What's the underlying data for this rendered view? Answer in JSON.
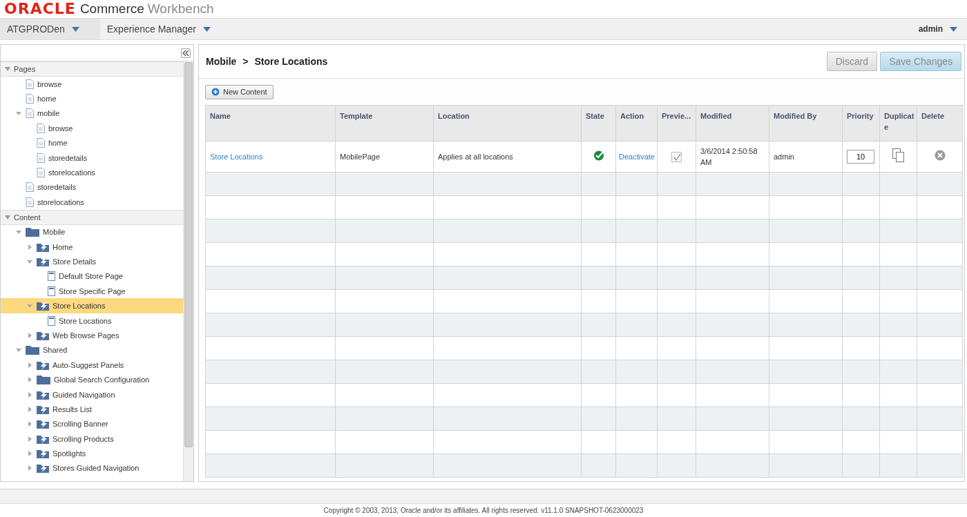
{
  "header": {
    "brand": "ORACLE",
    "product": "Commerce",
    "product_suffix": "Workbench"
  },
  "nav": {
    "menus": [
      {
        "label": "ATGPRODen",
        "selected": true
      },
      {
        "label": "Experience Manager",
        "selected": false
      }
    ],
    "user": "admin"
  },
  "sidebar": {
    "sections": [
      {
        "label": "Pages",
        "expanded": true,
        "items": [
          {
            "label": "browse",
            "kind": "page",
            "selected": false
          },
          {
            "label": "home",
            "kind": "page",
            "selected": false
          },
          {
            "label": "mobile",
            "kind": "page",
            "selected": false,
            "expanded": true,
            "children": [
              {
                "label": "browse",
                "kind": "page",
                "selected": false
              },
              {
                "label": "home",
                "kind": "page",
                "selected": false
              },
              {
                "label": "storedetails",
                "kind": "page",
                "selected": false
              },
              {
                "label": "storelocations",
                "kind": "page",
                "selected": false
              }
            ]
          },
          {
            "label": "storedetails",
            "kind": "page",
            "selected": false
          },
          {
            "label": "storelocations",
            "kind": "page",
            "selected": false
          }
        ]
      },
      {
        "label": "Content",
        "expanded": true,
        "items": [
          {
            "label": "Mobile",
            "kind": "folder",
            "selected": false,
            "expanded": true,
            "children": [
              {
                "label": "Home",
                "kind": "collection",
                "selected": false,
                "expanded": false
              },
              {
                "label": "Store Details",
                "kind": "collection",
                "selected": false,
                "expanded": true,
                "children": [
                  {
                    "label": "Default Store Page",
                    "kind": "doc",
                    "selected": false
                  },
                  {
                    "label": "Store Specific Page",
                    "kind": "doc",
                    "selected": false
                  }
                ]
              },
              {
                "label": "Store Locations",
                "kind": "collection",
                "selected": true,
                "expanded": true,
                "children": [
                  {
                    "label": "Store Locations",
                    "kind": "doc",
                    "selected": false
                  }
                ]
              },
              {
                "label": "Web Browse Pages",
                "kind": "collection",
                "selected": false,
                "expanded": false
              }
            ]
          },
          {
            "label": "Shared",
            "kind": "folder",
            "selected": false,
            "expanded": true,
            "children": [
              {
                "label": "Auto-Suggest Panels",
                "kind": "collection",
                "selected": false,
                "expanded": false
              },
              {
                "label": "Global Search Configuration",
                "kind": "folder",
                "selected": false,
                "expanded": false
              },
              {
                "label": "Guided Navigation",
                "kind": "collection",
                "selected": false,
                "expanded": false
              },
              {
                "label": "Results List",
                "kind": "collection",
                "selected": false,
                "expanded": false
              },
              {
                "label": "Scrolling Banner",
                "kind": "collection",
                "selected": false,
                "expanded": false
              },
              {
                "label": "Scrolling Products",
                "kind": "collection",
                "selected": false,
                "expanded": false
              },
              {
                "label": "Spotlights",
                "kind": "collection",
                "selected": false,
                "expanded": false
              },
              {
                "label": "Stores Guided Navigation",
                "kind": "collection",
                "selected": false,
                "expanded": false
              }
            ]
          }
        ]
      }
    ]
  },
  "main": {
    "breadcrumb": [
      "Mobile",
      ">",
      "Store Locations"
    ],
    "buttons": [
      {
        "label": "Discard",
        "kind": "secondary",
        "disabled": true
      },
      {
        "label": "Save Changes",
        "kind": "primary",
        "disabled": true
      }
    ],
    "new_button": "New Content",
    "table": {
      "columns": [
        "Name",
        "Template",
        "Location",
        "State",
        "Action",
        "Previe...",
        "Modified",
        "Modified By",
        "Priority",
        "Duplicate",
        "Delete"
      ],
      "rows": [
        {
          "name": "Store Locations",
          "template": "MobilePage",
          "location": "Applies at all locations",
          "active": true,
          "action": "Deactivate",
          "preview": true,
          "modified": "3/6/2014 2:50:58 AM",
          "modified_by": "admin",
          "priority": "10"
        }
      ]
    }
  },
  "footer": "Copyright © 2003, 2013, Oracle and/or its affiliates. All rights reserved. v11.1.0 SNAPSHOT-0623000023"
}
